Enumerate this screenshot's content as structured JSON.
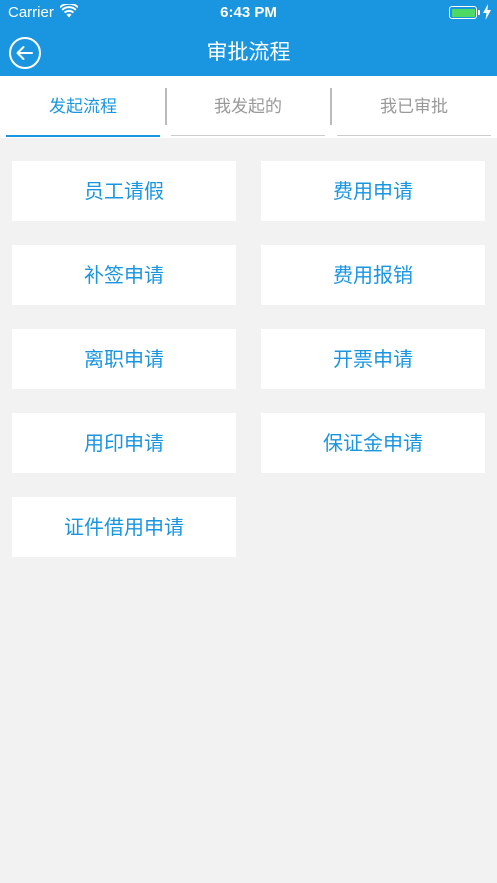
{
  "status_bar": {
    "carrier": "Carrier",
    "time": "6:43 PM"
  },
  "nav": {
    "title": "审批流程"
  },
  "tabs": [
    {
      "label": "发起流程",
      "active": true
    },
    {
      "label": "我发起的",
      "active": false
    },
    {
      "label": "我已审批",
      "active": false
    }
  ],
  "items": [
    {
      "label": "员工请假"
    },
    {
      "label": "费用申请"
    },
    {
      "label": "补签申请"
    },
    {
      "label": "费用报销"
    },
    {
      "label": "离职申请"
    },
    {
      "label": "开票申请"
    },
    {
      "label": "用印申请"
    },
    {
      "label": "保证金申请"
    },
    {
      "label": "证件借用申请"
    }
  ],
  "colors": {
    "accent": "#1a95e0",
    "background": "#f2f2f2",
    "battery": "#4cd964"
  }
}
